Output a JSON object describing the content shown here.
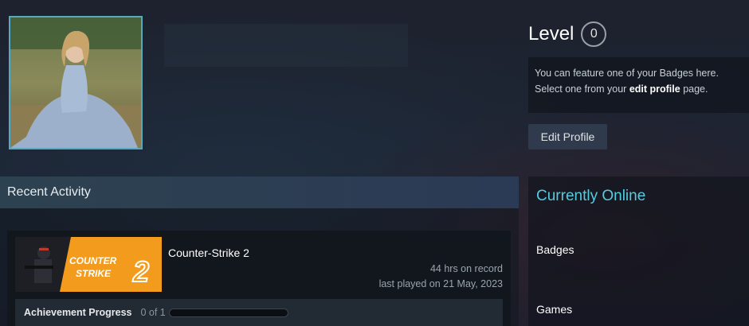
{
  "profile": {
    "avatar_alt": "profile avatar"
  },
  "level": {
    "label": "Level",
    "value": "0"
  },
  "badge_box": {
    "line1": "You can feature one of your Badges here.",
    "line2_prefix": "Select one from your ",
    "line2_link": "edit profile",
    "line2_suffix": " page."
  },
  "buttons": {
    "edit_profile": "Edit Profile"
  },
  "recent_activity": {
    "header": "Recent Activity",
    "games": [
      {
        "title": "Counter-Strike 2",
        "hours": "44 hrs on record",
        "last_played": "last played on 21 May, 2023",
        "achievement_label": "Achievement Progress",
        "achievement_count": "0 of 1",
        "achievement_progress": 0,
        "banner_text_1": "COUNTER",
        "banner_text_2": "STRIKE",
        "banner_number": "2"
      }
    ]
  },
  "sidebar": {
    "status": "Currently Online",
    "links": [
      "Badges",
      "Games"
    ]
  },
  "colors": {
    "accent_online": "#57cbde",
    "avatar_border": "#57a8c2",
    "banner_orange": "#f39b1c"
  }
}
